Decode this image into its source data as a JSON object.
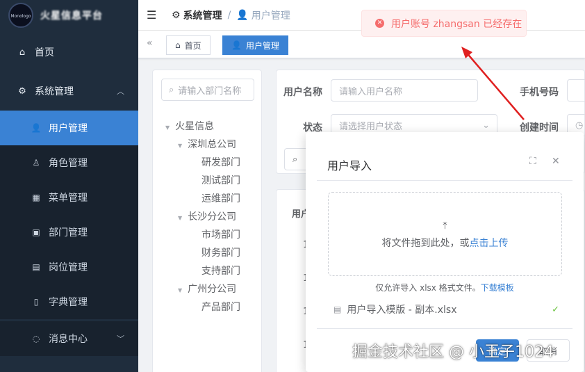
{
  "sidebar": {
    "logo_text": "Monologo",
    "brand": "火星信息平台",
    "items": [
      {
        "label": "首页",
        "icon": "home-icon"
      },
      {
        "label": "系统管理",
        "icon": "gear-icon"
      },
      {
        "label": "用户管理",
        "icon": "user-icon"
      },
      {
        "label": "角色管理",
        "icon": "person-icon"
      },
      {
        "label": "菜单管理",
        "icon": "grid-icon"
      },
      {
        "label": "部门管理",
        "icon": "id-card-icon"
      },
      {
        "label": "岗位管理",
        "icon": "badge-icon"
      },
      {
        "label": "字典管理",
        "icon": "book-icon"
      },
      {
        "label": "消息中心",
        "icon": "message-icon"
      }
    ]
  },
  "navbar": {
    "section": "系统管理",
    "separator": "/",
    "page": "用户管理"
  },
  "tags": {
    "home": "首页",
    "current": "用户管理"
  },
  "tree": {
    "placeholder": "请输入部门名称",
    "nodes": [
      "火星信息",
      "深圳总公司",
      "研发部门",
      "测试部门",
      "运维部门",
      "长沙分公司",
      "市场部门",
      "财务部门",
      "支持部门",
      "广州分公司",
      "产品部门"
    ]
  },
  "form": {
    "username_label": "用户名称",
    "username_placeholder": "请输入用户名称",
    "phone_label": "手机号码",
    "status_label": "状态",
    "status_placeholder": "请选择用户状态",
    "created_label": "创建时间"
  },
  "table": {
    "header": "用户",
    "row_value": "1"
  },
  "dialog": {
    "title": "用户导入",
    "drop_text": "将文件拖到此处，或",
    "upload_link": "点击上传",
    "tip": "仅允许导入 xlsx 格式文件。",
    "template_link": "下载模板",
    "file_name": "用户导入模版 - 副本.xlsx",
    "ok": "确定",
    "cancel": "取消"
  },
  "toast": {
    "message": "用户账号 zhangsan 已经存在",
    "color": "#f56c6c"
  },
  "watermark": "掘金技术社区 @ 小王子1024",
  "colors": {
    "primary": "#3a82d4",
    "sidebar_bg": "#1f2d3d",
    "error": "#f56c6c",
    "success": "#67c23a"
  }
}
